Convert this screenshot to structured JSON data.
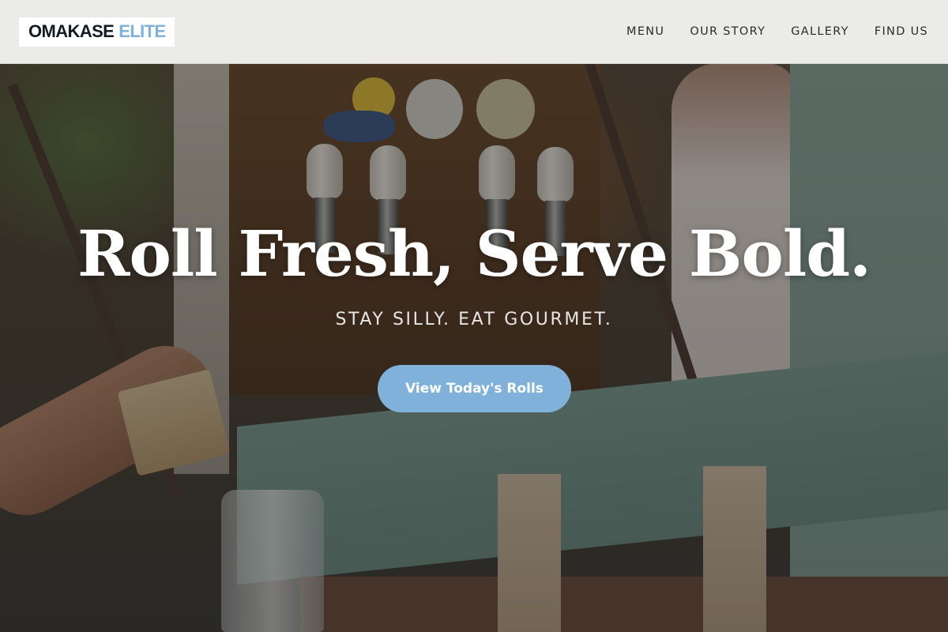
{
  "header": {
    "logo_part1": "OMAKASE",
    "logo_part2": "ELITE",
    "nav": [
      {
        "label": "MENU"
      },
      {
        "label": "OUR STORY"
      },
      {
        "label": "GALLERY"
      },
      {
        "label": "FIND US"
      }
    ]
  },
  "hero": {
    "title": "Roll Fresh, Serve Bold.",
    "subtitle": "STAY SILLY. EAT GOURMET.",
    "cta_label": "View Today's Rolls",
    "background_image": "food-truck-photo"
  },
  "colors": {
    "accent": "#7fb1da",
    "logo_dark": "#141a24",
    "nav_bg": "#f6f6f6"
  }
}
